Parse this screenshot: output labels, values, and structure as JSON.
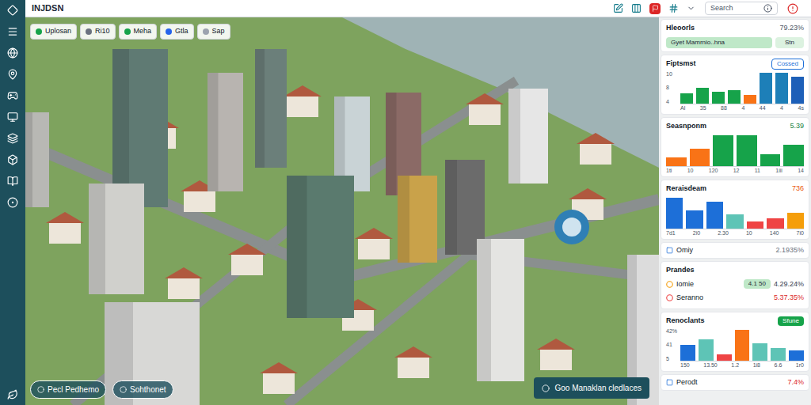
{
  "app": {
    "title": "INJDSN"
  },
  "search": {
    "placeholder": "Search"
  },
  "view_chips": [
    {
      "label": "Uplosan",
      "color": "#16a34a"
    },
    {
      "label": "Ri10",
      "color": "#6b7280"
    },
    {
      "label": "Meha",
      "color": "#16a34a"
    },
    {
      "label": "Gtla",
      "color": "#2563eb"
    },
    {
      "label": "Sap",
      "color": "#9ca3af"
    }
  ],
  "view_buttons": [
    {
      "label": "Pecl Pedhemo"
    },
    {
      "label": "Sohthonet"
    }
  ],
  "action_button": {
    "label": "Goo Manaklan cledlaces"
  },
  "panel": [
    {
      "kind": "summary",
      "title": "Hleoorls",
      "value": "79.23%",
      "row_label": "Gyet Mamrnio..hna",
      "tag": "Stn"
    },
    {
      "kind": "chart",
      "title": "Fiptsmst",
      "badge": "Cossed",
      "badge_style": "outline",
      "y_ticks": [
        "10",
        "8",
        "4"
      ],
      "x_ticks": [
        "Al",
        "35",
        "88",
        "4",
        "44",
        "4",
        "4s"
      ],
      "values": [
        2.5,
        3.8,
        2.8,
        3.2,
        2,
        7.5,
        7.5,
        6.5
      ],
      "colors": [
        "#16a34a",
        "#16a34a",
        "#16a34a",
        "#16a34a",
        "#f97316",
        "#1d7fb8",
        "#1d7fb8",
        "#1d5fb8"
      ]
    },
    {
      "kind": "chart",
      "title": "Seasnponm",
      "value": "5.39",
      "value_color": "#15803d",
      "y_ticks": [],
      "x_ticks": [
        "1ti",
        "10",
        "120",
        "12",
        "11",
        "1iii",
        "14"
      ],
      "values": [
        1.5,
        3,
        5.5,
        5.5,
        2,
        3.8
      ],
      "colors": [
        "#f97316",
        "#f97316",
        "#16a34a",
        "#16a34a",
        "#16a34a",
        "#16a34a"
      ]
    },
    {
      "kind": "chart",
      "title": "Reraisdeam",
      "value": "736",
      "value_color": "#ea580c",
      "y_ticks": [],
      "x_ticks": [
        "7d1",
        "2i0",
        "2.30",
        "10",
        "140",
        "7i0"
      ],
      "values": [
        5.5,
        3.2,
        4.8,
        2.5,
        1.2,
        1.8,
        2.8
      ],
      "colors": [
        "#1d6fd8",
        "#1d6fd8",
        "#1d6fd8",
        "#5ec4b6",
        "#ef4444",
        "#ef4444",
        "#f59e0b"
      ]
    },
    {
      "kind": "row",
      "title": "Omiy",
      "value": "2.1935%",
      "value_color": "#6b7280"
    },
    {
      "kind": "list",
      "title": "Prandes",
      "items": [
        {
          "label": "Iomie",
          "badge": "4.1 50",
          "value": "4.29.24%",
          "color": "#f59e0b",
          "value_color": "#374151"
        },
        {
          "label": "Seranno",
          "value": "5.37.35%",
          "color": "#ef4444",
          "value_color": "#dc2626"
        }
      ]
    },
    {
      "kind": "chart",
      "title": "Renoclants",
      "badge": "Sfune",
      "badge_style": "solid",
      "y_ticks": [
        "42%",
        "41",
        "5"
      ],
      "x_ticks": [
        "150",
        "13.50",
        "1.2",
        "1i8",
        "6.6",
        "1r0"
      ],
      "values": [
        2.8,
        3.8,
        1,
        5.5,
        3,
        2.2,
        1.8
      ],
      "colors": [
        "#1d6fd8",
        "#5ec4b6",
        "#ef4444",
        "#f97316",
        "#5ec4b6",
        "#5ec4b6",
        "#1d6fd8"
      ]
    },
    {
      "kind": "row",
      "title": "Perodt",
      "value": "7.4%",
      "value_color": "#dc2626"
    }
  ]
}
